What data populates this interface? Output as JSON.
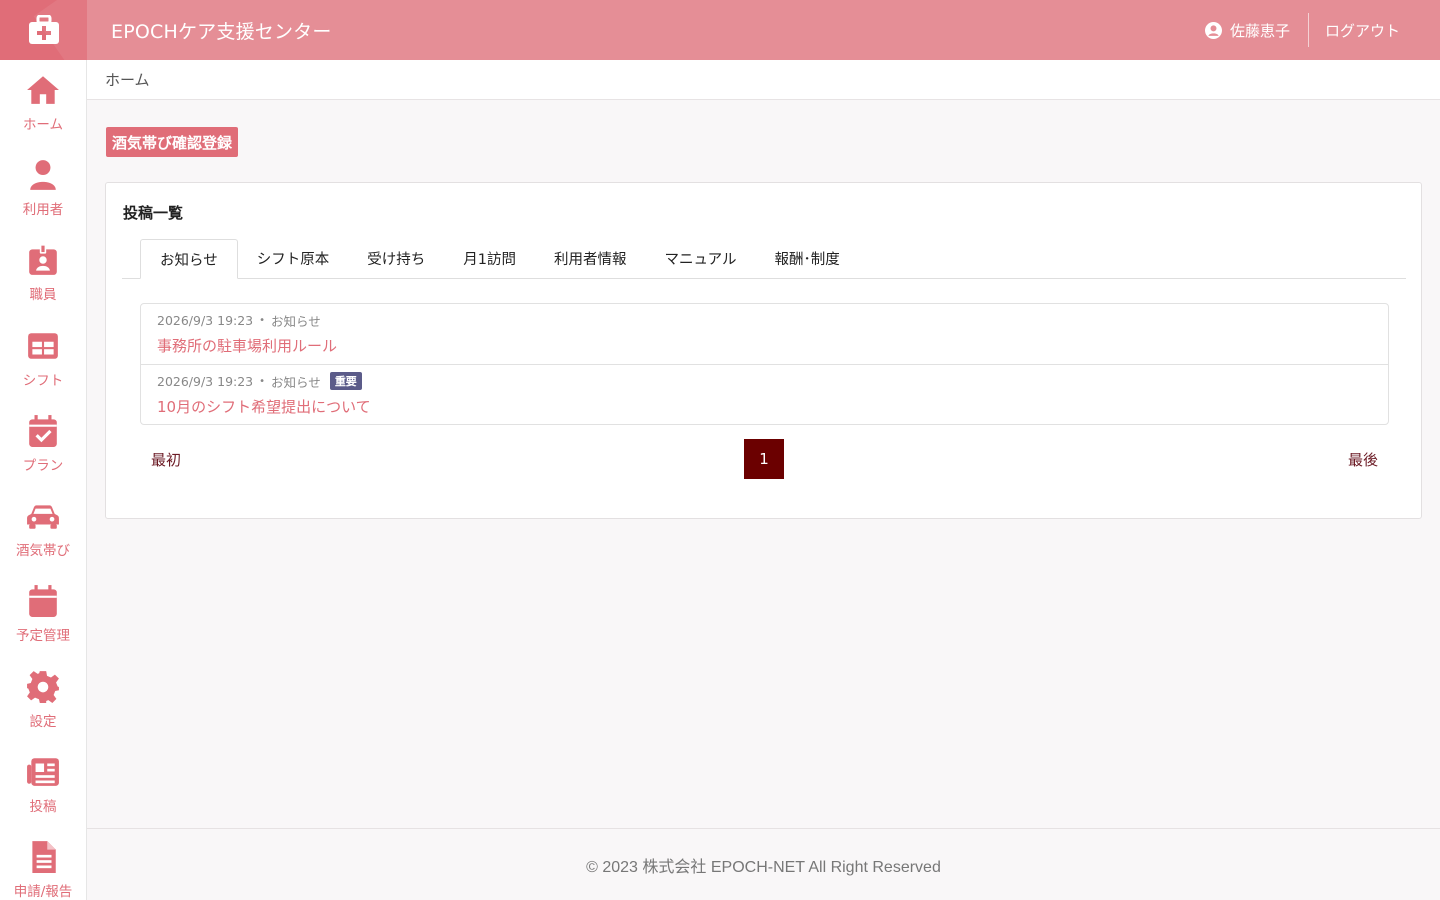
{
  "header": {
    "title": "EPOCHケア支援センター",
    "user_name": "佐藤恵子",
    "logout_label": "ログアウト",
    "colors": {
      "header_bg": "#e58e96",
      "logo_bg": "#e06d78",
      "accent": "#e06d78"
    }
  },
  "sidebar": {
    "items": [
      {
        "label": "ホーム",
        "icon": "home-icon"
      },
      {
        "label": "利用者",
        "icon": "user-icon"
      },
      {
        "label": "職員",
        "icon": "id-badge-icon"
      },
      {
        "label": "シフト",
        "icon": "table-icon"
      },
      {
        "label": "プラン",
        "icon": "calendar-check-icon"
      },
      {
        "label": "酒気帯び",
        "icon": "car-icon"
      },
      {
        "label": "予定管理",
        "icon": "calendar-icon"
      },
      {
        "label": "設定",
        "icon": "gear-icon"
      },
      {
        "label": "投稿",
        "icon": "newspaper-icon"
      },
      {
        "label": "申請/報告",
        "icon": "document-icon"
      }
    ]
  },
  "breadcrumb": {
    "current": "ホーム"
  },
  "actions": {
    "alcohol_check_button": "酒気帯び確認登録"
  },
  "posts_card": {
    "title": "投稿一覧",
    "tabs": [
      {
        "label": "お知らせ",
        "active": true
      },
      {
        "label": "シフト原本"
      },
      {
        "label": "受け持ち"
      },
      {
        "label": "月1訪問"
      },
      {
        "label": "利用者情報"
      },
      {
        "label": "マニュアル"
      },
      {
        "label": "報酬･制度"
      }
    ],
    "posts": [
      {
        "datetime": "2026/9/3 19:23",
        "category": "お知らせ",
        "badge": "",
        "title": "事務所の駐車場利用ルール"
      },
      {
        "datetime": "2026/9/3 19:23",
        "category": "お知らせ",
        "badge": "重要",
        "title": "10月のシフト希望提出について"
      }
    ],
    "pagination": {
      "first": "最初",
      "current": "1",
      "last": "最後"
    }
  },
  "footer": {
    "copyright": "© 2023 株式会社 EPOCH-NET All Right Reserved"
  }
}
